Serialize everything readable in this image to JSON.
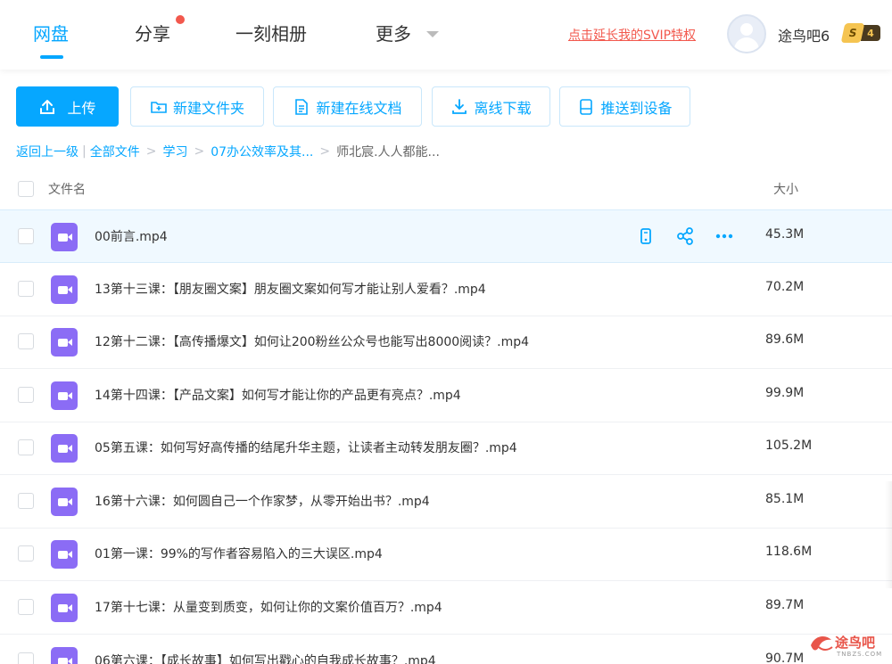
{
  "nav": {
    "tabs": [
      {
        "label": "网盘",
        "active": true
      },
      {
        "label": "分享",
        "active": false,
        "has_dot": true
      },
      {
        "label": "一刻相册",
        "active": false
      },
      {
        "label": "更多",
        "active": false,
        "has_dropdown": true
      }
    ],
    "svip_link": "点击延长我的SVIP特权",
    "username": "途鸟吧6",
    "vip_level_letter": "S",
    "vip_level_num": "4",
    "accent_color": "#06a7ff",
    "alert_color": "#f2584d"
  },
  "toolbar": {
    "upload": "上传",
    "new_folder": "新建文件夹",
    "new_doc": "新建在线文档",
    "offline_download": "离线下载",
    "push_device": "推送到设备"
  },
  "breadcrumb": {
    "back": "返回上一级",
    "items": [
      "全部文件",
      "学习",
      "07办公效率及其..."
    ],
    "current": "师北宸.人人都能..."
  },
  "table": {
    "header_name": "文件名",
    "header_size": "大小",
    "rows": [
      {
        "name": "00前言.mp4",
        "size": "45.3M",
        "hover": true
      },
      {
        "name": "13第十三课：【朋友圈文案】朋友圈文案如何写才能让别人爱看？.mp4",
        "size": "70.2M"
      },
      {
        "name": "12第十二课：【高传播爆文】如何让200粉丝公众号也能写出8000阅读？.mp4",
        "size": "89.6M"
      },
      {
        "name": "14第十四课：【产品文案】如何写才能让你的产品更有亮点？.mp4",
        "size": "99.9M"
      },
      {
        "name": "05第五课：如何写好高传播的结尾升华主题，让读者主动转发朋友圈？.mp4",
        "size": "105.2M"
      },
      {
        "name": "16第十六课：如何圆自己一个作家梦，从零开始出书？.mp4",
        "size": "85.1M"
      },
      {
        "name": "01第一课：99%的写作者容易陷入的三大误区.mp4",
        "size": "118.6M"
      },
      {
        "name": "17第十七课：从量变到质变，如何让你的文案价值百万？.mp4",
        "size": "89.7M"
      },
      {
        "name": "06第六课：【成长故事】如何写出戳心的自我成长故事？.mp4",
        "size": "90.7M"
      }
    ]
  },
  "watermark": {
    "text": "途鸟吧",
    "sub": "TNBZS.COM"
  }
}
